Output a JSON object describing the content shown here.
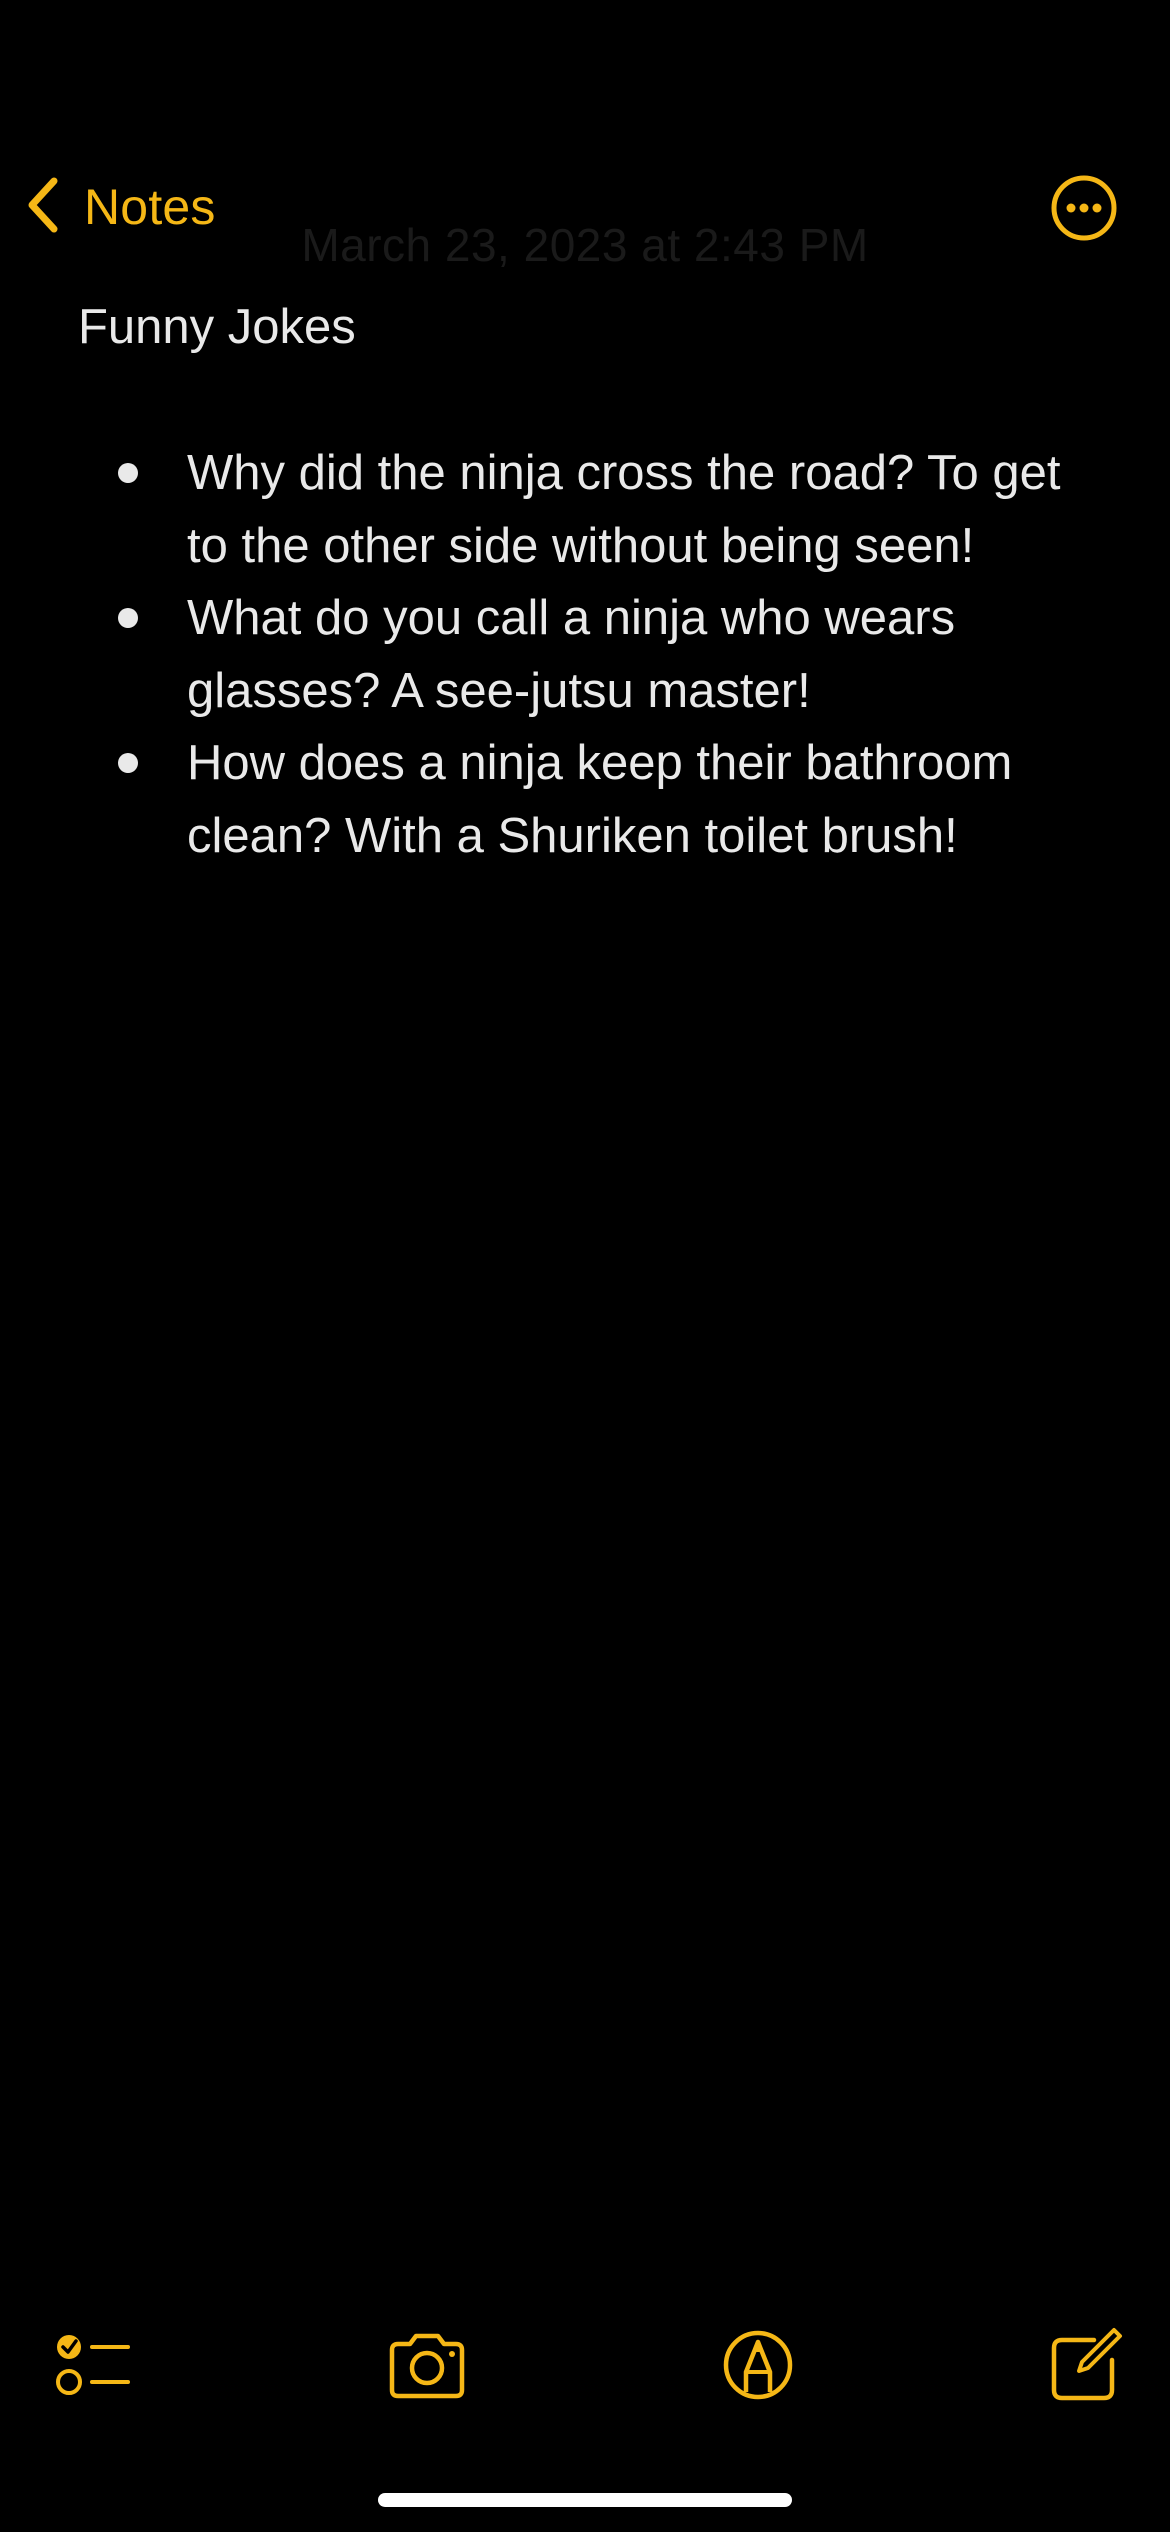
{
  "nav": {
    "back_label": "Notes",
    "date_label": "March 23, 2023 at 2:43 PM",
    "more_icon": "ellipsis-circle-icon"
  },
  "note": {
    "title": "Funny Jokes",
    "items": [
      "Why did the ninja cross the road? To get to the other side without being seen!",
      "What do you call a ninja who wears glasses? A see-jutsu master!",
      "How does a ninja keep their bathroom clean? With a Shuriken toilet brush!"
    ]
  },
  "toolbar": {
    "icons": [
      "checklist-icon",
      "camera-icon",
      "markup-pen-icon",
      "compose-icon"
    ]
  },
  "colors": {
    "accent": "#f5b716",
    "background": "#000000",
    "text": "#e9e9e9"
  }
}
